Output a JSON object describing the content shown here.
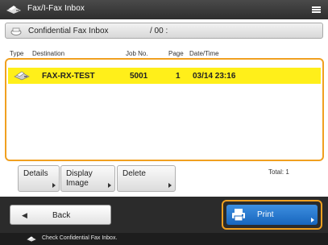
{
  "window": {
    "title": "Fax/I-Fax Inbox",
    "icon": "fax-machine-icon",
    "menu_icon": "hamburger-menu-icon"
  },
  "box": {
    "name": "Confidential Fax Inbox",
    "number": "/ 00 :",
    "icon": "tray-icon"
  },
  "columns": {
    "type": "Type",
    "destination": "Destination",
    "job_no": "Job No.",
    "page": "Page",
    "datetime": "Date/Time"
  },
  "jobs": [
    {
      "type_icon": "fax-machine-icon",
      "destination": "FAX-RX-TEST",
      "job_no": "5001",
      "page": "1",
      "datetime": "03/14 23:16",
      "selected": true
    }
  ],
  "actions": {
    "details": "Details",
    "display_image": "Display\nImage",
    "delete": "Delete",
    "total": "Total: 1"
  },
  "footer": {
    "back": "Back",
    "print": "Print",
    "back_icon": "left-arrow-icon",
    "print_icon": "printer-icon"
  },
  "status": {
    "message": "Check Confidential Fax Inbox.",
    "icon": "fax-machine-icon"
  },
  "colors": {
    "selected_row": "#ffef1a",
    "focus_outline": "#f0a020",
    "print_button": "#1f73c9",
    "title_bar": "#3a3a3a"
  }
}
